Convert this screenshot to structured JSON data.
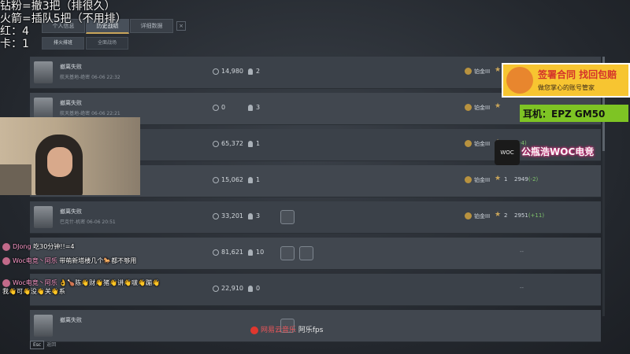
{
  "notes": [
    "钻粉=撤3把（排很久）",
    "火箭=插队5把（不用排）",
    "红：4",
    "卡：1"
  ],
  "tabs": {
    "items": [
      "个人信息",
      "历史战绩",
      "详细数据"
    ],
    "active_index": 1,
    "close": "×"
  },
  "subtabs": {
    "items": [
      "排火排班",
      "全面战场"
    ],
    "active_index": 0
  },
  "rows": [
    {
      "mode": "撤离失败",
      "sub": "航天基地-绝密 06-06 22:32",
      "score": "14,980",
      "kills": "2",
      "rank": "铂金III",
      "stars": "",
      "rating": "",
      "delta": "",
      "dash": "",
      "medals": 0
    },
    {
      "mode": "撤离失败",
      "sub": "航天基地-绝密 06-06 22:21",
      "score": "0",
      "kills": "3",
      "rank": "铂金III",
      "stars": "",
      "rating": "",
      "delta": "",
      "dash": "",
      "medals": 0
    },
    {
      "mode": "",
      "sub": "",
      "score": "65,372",
      "kills": "1",
      "rank": "铂金III",
      "stars": "",
      "rating": "",
      "delta": "(+4)",
      "dash": "",
      "medals": 0
    },
    {
      "mode": "",
      "sub": "",
      "score": "15,062",
      "kills": "1",
      "rank": "铂金III",
      "stars": "1",
      "rating": "2949",
      "delta": "(-2)",
      "dash": "",
      "medals": 0
    },
    {
      "mode": "撤离失败",
      "sub": "巴克什-机密 06-06 20:51",
      "score": "33,201",
      "kills": "3",
      "rank": "铂金III",
      "stars": "2",
      "rating": "2951",
      "delta": "(+11)",
      "dash": "",
      "medals": 1
    },
    {
      "mode": "",
      "sub": "",
      "score": "81,621",
      "kills": "10",
      "rank": "",
      "stars": "",
      "rating": "",
      "delta": "",
      "dash": "--",
      "medals": 2
    },
    {
      "mode": "",
      "sub": "",
      "score": "22,910",
      "kills": "0",
      "rank": "",
      "stars": "",
      "rating": "",
      "delta": "",
      "dash": "--",
      "medals": 0
    },
    {
      "mode": "撤离失败",
      "sub": "",
      "score": "",
      "kills": "",
      "rank": "",
      "stars": "",
      "rating": "",
      "delta": "",
      "dash": "",
      "medals": 1
    }
  ],
  "sponsor": {
    "title": "签署合同 找回包赔",
    "subtitle": "做您掌心的账号管家"
  },
  "headset": "耳机：EPZ GM50",
  "woc": {
    "logo": "WOC",
    "text": "公瓶浩WOC电竞"
  },
  "chat": [
    {
      "who": "DJong",
      "text": "吃30分钟!!=4"
    },
    {
      "who": "Woc电竞丶阿乐",
      "text": "带萌新塔楼几个🐎都不够用"
    },
    {
      "who": "Woc电竞丶阿乐",
      "text": "👌🍗陈👋财👋猪👋讲👋啵👋蹦👋我👋可👋没👋关👋系"
    }
  ],
  "music": {
    "source": "网易云音乐",
    "name": "阿乐fps"
  },
  "esc": {
    "key": "Esc",
    "label": "返回"
  }
}
